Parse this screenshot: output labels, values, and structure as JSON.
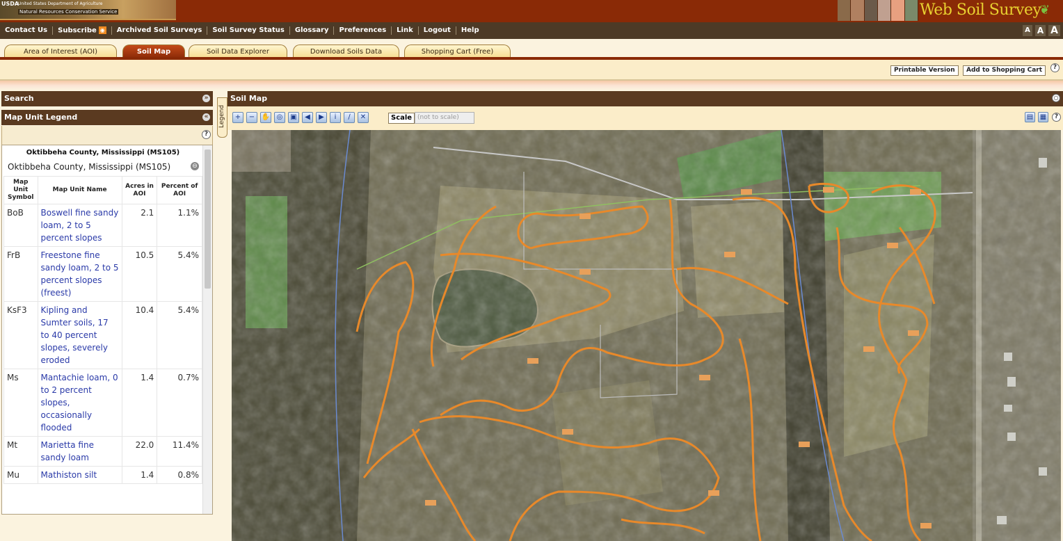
{
  "header": {
    "agency_mark": "USDA",
    "agency_line1": "United States Department of Agriculture",
    "agency_line2": "Natural Resources Conservation Service",
    "app_title": "Web Soil Survey",
    "brand_color": "#8a2a06"
  },
  "nav": {
    "links": [
      "Contact Us",
      "Subscribe",
      "Archived Soil Surveys",
      "Soil Survey Status",
      "Glossary",
      "Preferences",
      "Link",
      "Logout",
      "Help"
    ],
    "text_sizes": [
      "A",
      "A",
      "A"
    ]
  },
  "tabs": [
    {
      "label": "Area of Interest (AOI)",
      "active": false
    },
    {
      "label": "Soil Map",
      "active": true
    },
    {
      "label": "Soil Data Explorer",
      "active": false
    },
    {
      "label": "Download Soils Data",
      "active": false
    },
    {
      "label": "Shopping Cart (Free)",
      "active": false
    }
  ],
  "actions": {
    "printable": "Printable Version",
    "add_cart": "Add to Shopping Cart",
    "help": "?"
  },
  "left_panel": {
    "search_title": "Search",
    "legend_title": "Map Unit Legend",
    "county_bold": "Oktibbeha County, Mississippi (MS105)",
    "county_plain": "Oktibbeha County, Mississippi (MS105)",
    "columns": [
      "Map Unit Symbol",
      "Map Unit Name",
      "Acres in AOI",
      "Percent of AOI"
    ],
    "rows": [
      {
        "symbol": "BoB",
        "name": "Boswell fine sandy loam, 2 to 5 percent slopes",
        "acres": "2.1",
        "percent": "1.1%"
      },
      {
        "symbol": "FrB",
        "name": "Freestone fine sandy loam, 2 to 5 percent slopes (freest)",
        "acres": "10.5",
        "percent": "5.4%"
      },
      {
        "symbol": "KsF3",
        "name": "Kipling and Sumter soils, 17 to 40 percent slopes, severely eroded",
        "acres": "10.4",
        "percent": "5.4%"
      },
      {
        "symbol": "Ms",
        "name": "Mantachie loam, 0 to 2 percent slopes, occasionally flooded",
        "acres": "1.4",
        "percent": "0.7%"
      },
      {
        "symbol": "Mt",
        "name": "Marietta fine sandy loam",
        "acres": "22.0",
        "percent": "11.4%"
      },
      {
        "symbol": "Mu",
        "name": "Mathiston silt",
        "acres": "1.4",
        "percent": "0.8%"
      }
    ]
  },
  "map": {
    "title": "Soil Map",
    "legend_tab": "Legend",
    "scale_label": "Scale",
    "scale_value": "(not to scale)",
    "boundary_color": "#e8892a"
  }
}
